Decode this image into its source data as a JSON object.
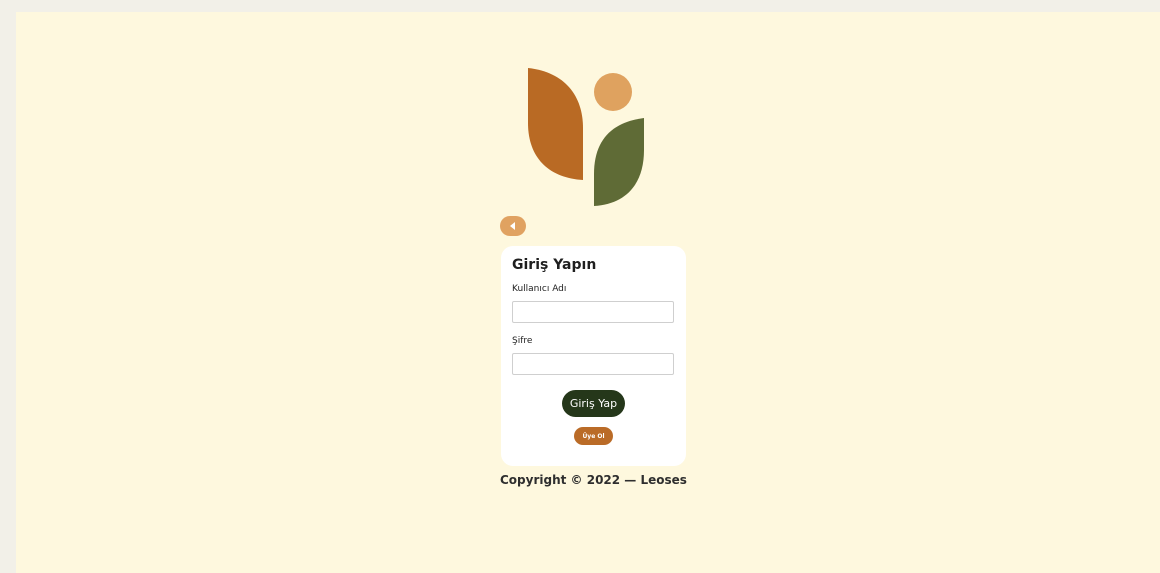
{
  "colors": {
    "page_background": "#fef8de",
    "outer_background": "#f2f0e8",
    "logo_orange_leaf": "#b96a24",
    "logo_circle": "#dfa25f",
    "logo_green_leaf": "#5f6b36",
    "back_button": "#e0a261",
    "login_button": "#25371a",
    "register_button": "#ba6b27"
  },
  "logo": {
    "icon": "plant-leaves-logo"
  },
  "back_button": {
    "icon": "caret-left-icon"
  },
  "login_form": {
    "title": "Giriş Yapın",
    "username_label": "Kullanıcı Adı",
    "username_value": "",
    "password_label": "Şifre",
    "password_value": "",
    "submit_label": "Giriş Yap",
    "register_label": "Üye Ol"
  },
  "footer": {
    "copyright": "Copyright © 2022 — Leoses"
  }
}
